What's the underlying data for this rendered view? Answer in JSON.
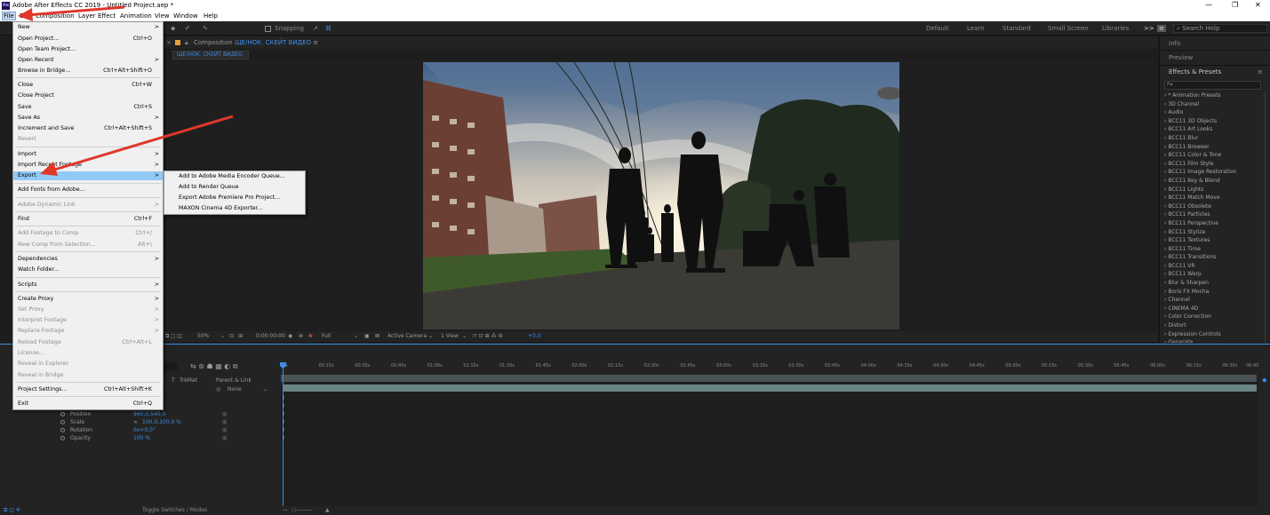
{
  "titlebar": {
    "app_icon": "Ae",
    "title": "Adobe After Effects CC 2019 - Untitled Project.aep *",
    "minimize_icon": "minimize-icon",
    "restore_icon": "restore-icon",
    "close_icon": "close-icon"
  },
  "menubar": {
    "items": [
      "File",
      "Edit",
      "Composition",
      "Layer",
      "Effect",
      "Animation",
      "View",
      "Window",
      "Help"
    ]
  },
  "toolbar": {
    "snapping": "Snapping",
    "workspaces": [
      "Default",
      "Learn",
      "Standard",
      "Small Screen",
      "Libraries"
    ],
    "more": ">>",
    "search_placeholder": "Search Help"
  },
  "comp": {
    "header_prefix": "Composition",
    "comp_name": "ЩЕ/НОК. СКЕЙТ ВИДЕО",
    "tab_name": "ЩЕ/НОК. СКЕЙТ ВИДЕО",
    "zoom": "50%",
    "timecode": "0:00:00:00",
    "resolution": "Full",
    "camera": "Active Camera",
    "views": "1 View",
    "exposure": "+0,0"
  },
  "right_panel": {
    "info": "Info",
    "preview": "Preview",
    "effects_title": "Effects & Presets",
    "search_glyph": "Ρ▾",
    "effects": [
      "* Animation Presets",
      "3D Channel",
      "Audio",
      "BCC11 3D Objects",
      "BCC11 Art Looks",
      "BCC11 Blur",
      "BCC11 Browser",
      "BCC11 Color & Tone",
      "BCC11 Film Style",
      "BCC11 Image Restoration",
      "BCC11 Key & Blend",
      "BCC11 Lights",
      "BCC11 Match Move",
      "BCC11 Obsolete",
      "BCC11 Particles",
      "BCC11 Perspective",
      "BCC11 Stylize",
      "BCC11 Textures",
      "BCC11 Time",
      "BCC11 Transitions",
      "BCC11 VR",
      "BCC11 Warp",
      "Blur & Sharpen",
      "Boris FX Mocha",
      "Channel",
      "CINEMA 4D",
      "Color Correction",
      "Distort",
      "Expression Controls",
      "Generate"
    ]
  },
  "timeline": {
    "ticks": [
      "0s",
      "00:15s",
      "00:30s",
      "00:45s",
      "01:00s",
      "01:15s",
      "01:30s",
      "01:45s",
      "02:00s",
      "02:15s",
      "02:30s",
      "02:45s",
      "03:00s",
      "03:15s",
      "03:30s",
      "03:45s",
      "04:00s",
      "04:15s",
      "04:30s",
      "04:45s",
      "05:00s",
      "05:15s",
      "05:30s",
      "05:45s",
      "06:00s",
      "06:15s",
      "06:30s",
      "06:45"
    ],
    "col_t": "T",
    "col_trkmat": "TrkMat",
    "col_parent": "Parent & Link",
    "parent_value": "None",
    "properties": [
      {
        "name": "Position",
        "value": "960,0,540,0"
      },
      {
        "name": "Scale",
        "value": "100,0,100,0 %"
      },
      {
        "name": "Rotation",
        "value": "0x+0,0°"
      },
      {
        "name": "Opacity",
        "value": "100 %"
      }
    ],
    "toggle_label": "Toggle Switches / Modes",
    "kf_marker": "I"
  },
  "file_menu": {
    "items": [
      {
        "label": "New",
        "shortcut": "",
        "arrow": ">",
        "disabled": false
      },
      {
        "label": "Open Project...",
        "shortcut": "Ctrl+O",
        "arrow": "",
        "disabled": false
      },
      {
        "label": "Open Team Project...",
        "shortcut": "",
        "arrow": "",
        "disabled": false
      },
      {
        "label": "Open Recent",
        "shortcut": "",
        "arrow": ">",
        "disabled": false
      },
      {
        "label": "Browse in Bridge...",
        "shortcut": "Ctrl+Alt+Shift+O",
        "arrow": "",
        "disabled": false
      },
      {
        "label": "Close",
        "shortcut": "Ctrl+W",
        "arrow": "",
        "disabled": false
      },
      {
        "label": "Close Project",
        "shortcut": "",
        "arrow": "",
        "disabled": false
      },
      {
        "label": "Save",
        "shortcut": "Ctrl+S",
        "arrow": "",
        "disabled": false
      },
      {
        "label": "Save As",
        "shortcut": "",
        "arrow": ">",
        "disabled": false
      },
      {
        "label": "Increment and Save",
        "shortcut": "Ctrl+Alt+Shift+S",
        "arrow": "",
        "disabled": false
      },
      {
        "label": "Revert",
        "shortcut": "",
        "arrow": "",
        "disabled": true
      },
      {
        "label": "Import",
        "shortcut": "",
        "arrow": ">",
        "disabled": false
      },
      {
        "label": "Import Recent Footage",
        "shortcut": "",
        "arrow": ">",
        "disabled": false
      },
      {
        "label": "Export",
        "shortcut": "",
        "arrow": ">",
        "disabled": false
      },
      {
        "label": "Add Fonts from Adobe...",
        "shortcut": "",
        "arrow": "",
        "disabled": false
      },
      {
        "label": "Adobe Dynamic Link",
        "shortcut": "",
        "arrow": ">",
        "disabled": true
      },
      {
        "label": "Find",
        "shortcut": "Ctrl+F",
        "arrow": "",
        "disabled": false
      },
      {
        "label": "Add Footage to Comp",
        "shortcut": "Ctrl+/",
        "arrow": "",
        "disabled": true
      },
      {
        "label": "New Comp from Selection...",
        "shortcut": "Alt+\\",
        "arrow": "",
        "disabled": true
      },
      {
        "label": "Dependencies",
        "shortcut": "",
        "arrow": ">",
        "disabled": false
      },
      {
        "label": "Watch Folder...",
        "shortcut": "",
        "arrow": "",
        "disabled": false
      },
      {
        "label": "Scripts",
        "shortcut": "",
        "arrow": ">",
        "disabled": false
      },
      {
        "label": "Create Proxy",
        "shortcut": "",
        "arrow": ">",
        "disabled": false
      },
      {
        "label": "Set Proxy",
        "shortcut": "",
        "arrow": ">",
        "disabled": true
      },
      {
        "label": "Interpret Footage",
        "shortcut": "",
        "arrow": ">",
        "disabled": true
      },
      {
        "label": "Replace Footage",
        "shortcut": "",
        "arrow": ">",
        "disabled": true
      },
      {
        "label": "Reload Footage",
        "shortcut": "Ctrl+Alt+L",
        "arrow": "",
        "disabled": true
      },
      {
        "label": "License...",
        "shortcut": "",
        "arrow": "",
        "disabled": true
      },
      {
        "label": "Reveal in Explorer",
        "shortcut": "",
        "arrow": "",
        "disabled": true
      },
      {
        "label": "Reveal in Bridge",
        "shortcut": "",
        "arrow": "",
        "disabled": true
      },
      {
        "label": "Project Settings...",
        "shortcut": "Ctrl+Alt+Shift+K",
        "arrow": "",
        "disabled": false
      },
      {
        "label": "Exit",
        "shortcut": "Ctrl+Q",
        "arrow": "",
        "disabled": false
      }
    ]
  },
  "export_submenu": {
    "items": [
      "Add to Adobe Media Encoder Queue...",
      "Add to Render Queue",
      "Export Adobe Premiere Pro Project...",
      "MAXON Cinema 4D Exporter..."
    ]
  },
  "colors": {
    "accent": "#3c8fe8",
    "menu_highlight": "#91c9f7",
    "annotation_arrow": "#e0372b",
    "layer_bar": "#6a8584"
  }
}
